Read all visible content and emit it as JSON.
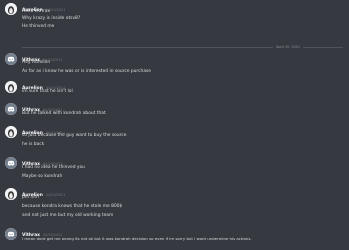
{
  "date_divider": "April 20, 2021",
  "groups": [
    {
      "author": "Aurelion",
      "timestamp": "04/20/2021",
      "avatar_icon": "penguin-avatar-icon",
      "messages": [
        "Hello vithrax",
        "Why krazy is inside otsv8?",
        "He thinved me"
      ]
    },
    {
      "author": "Vithrax",
      "timestamp": "04/20/2021",
      "avatar_icon": "discord-default-avatar-icon",
      "messages": [
        "Hey Aurelion",
        "As far as i know he was or is interested in source purchase"
      ]
    },
    {
      "author": "Aurelion",
      "timestamp": "04/20/2021",
      "avatar_icon": "penguin-avatar-icon",
      "messages": [
        "im sure that he isn't lol"
      ]
    },
    {
      "author": "Vithrax",
      "timestamp": "04/20/2021",
      "avatar_icon": "discord-default-avatar-icon",
      "messages": [
        "But he talked with kondrah about that"
      ]
    },
    {
      "author": "Aurelion",
      "timestamp": "04/20/2021",
      "avatar_icon": "penguin-avatar-icon",
      "messages": [
        "so just because the guy want to buy the source",
        "he is back"
      ]
    },
    {
      "author": "Vithrax",
      "timestamp": "04/20/2021",
      "avatar_icon": "discord-default-avatar-icon",
      "messages": [
        "I had no idea he thinved you",
        "Maybe so kondrah"
      ]
    },
    {
      "author": "Aurelion",
      "timestamp": "04/20/2021",
      "avatar_icon": "penguin-avatar-icon",
      "messages": [
        "pm him",
        "because kondra knows that he stole me 800$",
        "and not just me but my old working team"
      ]
    },
    {
      "author": "Vithrax",
      "timestamp": "04/20/2021",
      "avatar_icon": "discord-default-avatar-icon",
      "messages": [
        "I mean dont get me wrong its not ok but it was kondrah decision so even if im sorry but i wont undermine his actions."
      ]
    }
  ]
}
